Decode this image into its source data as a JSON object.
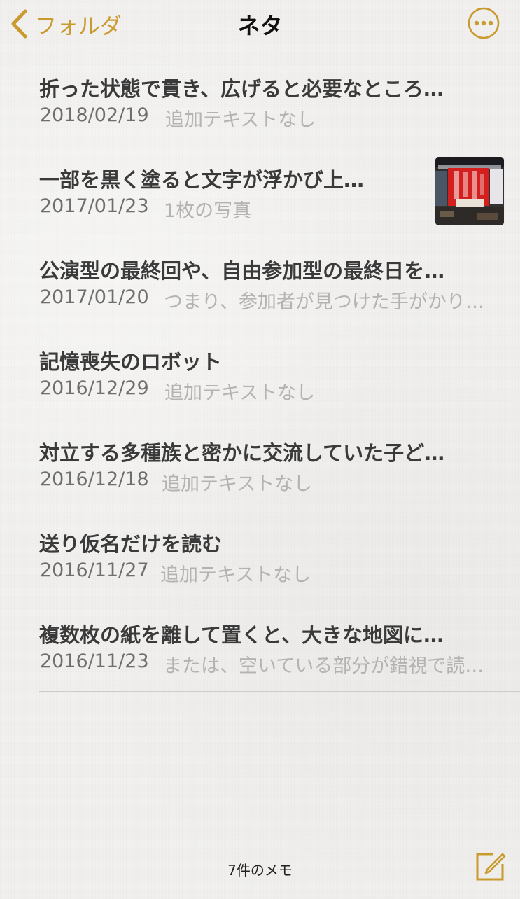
{
  "nav": {
    "back_label": "フォルダ",
    "title": "ネタ",
    "back_icon": "chevron-left-icon",
    "more_icon": "ellipsis-circle-icon"
  },
  "notes": [
    {
      "title": "折った状態で貫き、広げると必要なところ…",
      "date": "2018/02/19",
      "preview": "追加テキストなし",
      "has_thumbnail": false
    },
    {
      "title": "一部を黒く塗ると文字が浮かび上…",
      "date": "2017/01/23",
      "preview": "1枚の写真",
      "has_thumbnail": true
    },
    {
      "title": "公演型の最終回や、自由参加型の最終日を…",
      "date": "2017/01/20",
      "preview": "つまり、参加者が見つけた手がかり…",
      "has_thumbnail": false
    },
    {
      "title": "記憶喪失のロボット",
      "date": "2016/12/29",
      "preview": "追加テキストなし",
      "has_thumbnail": false
    },
    {
      "title": "対立する多種族と密かに交流していた子ど…",
      "date": "2016/12/18",
      "preview": "追加テキストなし",
      "has_thumbnail": false
    },
    {
      "title": "送り仮名だけを読む",
      "date": "2016/11/27",
      "preview": "追加テキストなし",
      "has_thumbnail": false
    },
    {
      "title": "複数枚の紙を離して置くと、大きな地図に…",
      "date": "2016/11/23",
      "preview": "または、空いている部分が錯視で読…",
      "has_thumbnail": false
    }
  ],
  "footer": {
    "count_label": "7件のメモ",
    "compose_icon": "compose-icon"
  },
  "colors": {
    "accent": "#c99a2e",
    "title_text": "#3a3a3a",
    "date_text": "#6e6e6e",
    "preview_text": "#b4b3b0",
    "divider": "#cfcecb",
    "background": "#f1f0ee"
  }
}
